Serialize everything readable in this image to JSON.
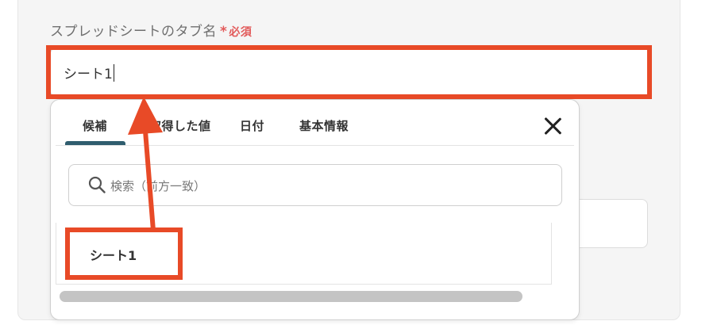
{
  "field": {
    "label": "スプレッドシートのタブ名",
    "required_mark": "*",
    "required_text": "必須",
    "value": "シート1"
  },
  "dropdown": {
    "tabs": [
      {
        "label": "候補",
        "active": true
      },
      {
        "label": "取得した値",
        "active": false
      },
      {
        "label": "日付",
        "active": false
      },
      {
        "label": "基本情報",
        "active": false
      }
    ],
    "search": {
      "icon": "search-icon",
      "placeholder": "検索（前方一致）"
    },
    "items": [
      {
        "label": "シート1"
      }
    ]
  },
  "colors": {
    "highlight": "#e84a27",
    "tab_active": "#2f5d6e",
    "required": "#e25a5a"
  }
}
